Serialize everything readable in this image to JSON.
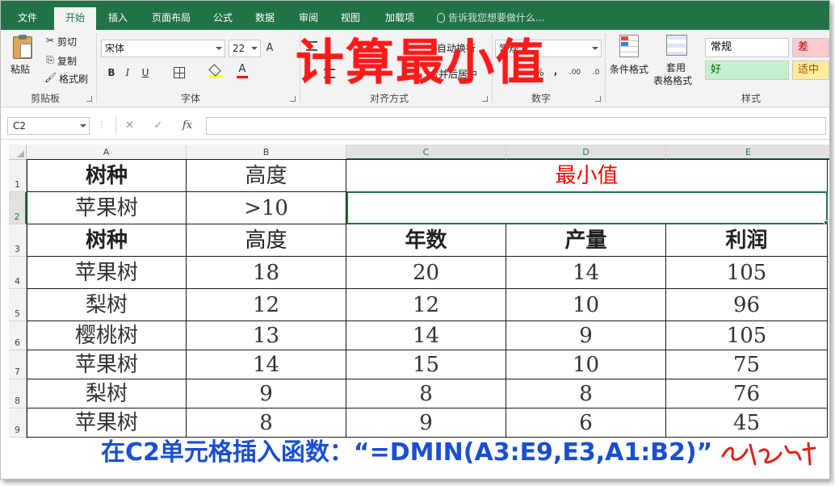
{
  "ribbon": {
    "tabs": [
      {
        "label": "文件",
        "active": false
      },
      {
        "label": "开始",
        "active": true
      },
      {
        "label": "插入",
        "active": false
      },
      {
        "label": "页面布局",
        "active": false
      },
      {
        "label": "公式",
        "active": false
      },
      {
        "label": "数据",
        "active": false
      },
      {
        "label": "审阅",
        "active": false
      },
      {
        "label": "视图",
        "active": false
      },
      {
        "label": "加载项",
        "active": false
      }
    ],
    "tell_me": "告诉我您想要做什么...",
    "clipboard": {
      "paste": "粘贴",
      "cut": "剪切",
      "copy": "复制",
      "format_painter": "格式刷",
      "label": "剪贴板"
    },
    "font": {
      "name": "宋体",
      "size": "22",
      "label": "字体",
      "bold": "B",
      "italic": "I",
      "underline": "U",
      "grow": "A",
      "shrink": "A",
      "font_color": "A"
    },
    "alignment": {
      "wrap": "自动换行",
      "merge": "合并后居中",
      "label": "对齐方式"
    },
    "number": {
      "format": "常规",
      "percent": "%",
      "comma": ",",
      "inc": ".00",
      "dec": ".0",
      "label": "数字"
    },
    "styles": {
      "conditional": "条件格式",
      "table": "套用",
      "table2": "表格格式",
      "normal": "常规",
      "bad": "差",
      "good": "好",
      "neutral": "适中",
      "label": "样式"
    }
  },
  "overlay_title": "计算最小值",
  "formula_bar": {
    "name_box": "C2",
    "cancel": "✕",
    "enter": "✓",
    "fx": "fx",
    "content": ""
  },
  "columns": [
    "A",
    "B",
    "C",
    "D",
    "E"
  ],
  "rows": [
    "1",
    "2",
    "3",
    "4",
    "5",
    "6",
    "7",
    "8",
    "9"
  ],
  "sheet": {
    "criteria_header": [
      "树种",
      "高度"
    ],
    "result_header": "最小值",
    "criteria_row": [
      "苹果树",
      ">10"
    ],
    "table_header": [
      "树种",
      "高度",
      "年数",
      "产量",
      "利润"
    ],
    "table_rows": [
      [
        "苹果树",
        "18",
        "20",
        "14",
        "105"
      ],
      [
        "梨树",
        "12",
        "12",
        "10",
        "96"
      ],
      [
        "樱桃树",
        "13",
        "14",
        "9",
        "105"
      ],
      [
        "苹果树",
        "14",
        "15",
        "10",
        "75"
      ],
      [
        "梨树",
        "9",
        "8",
        "8",
        "76"
      ],
      [
        "苹果树",
        "8",
        "9",
        "6",
        "45"
      ]
    ]
  },
  "note": "在C2单元格插入函数：“=DMIN(A3:E9,E3,A1:B2)”",
  "colors": {
    "excel_green": "#217346",
    "title_red": "#ff1a1a",
    "note_blue": "#1a4fd0"
  }
}
